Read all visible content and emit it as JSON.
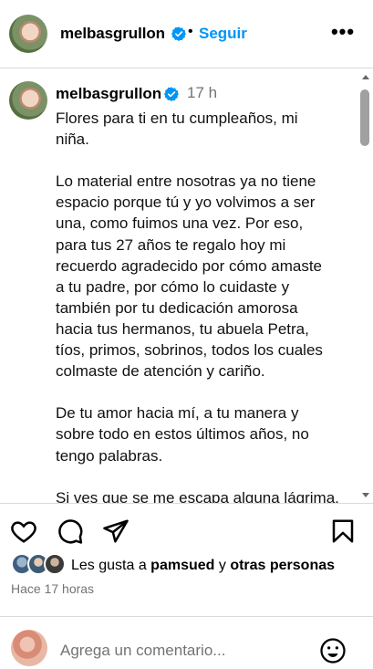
{
  "header": {
    "username": "melbasgrullon",
    "follow_label": "Seguir",
    "dot": "•",
    "more": "•••"
  },
  "post": {
    "username": "melbasgrullon",
    "time": "17 h",
    "caption": "Flores para ti en tu cumpleaños, mi\nniña.\n\nLo material entre nosotras ya no tiene\nespacio porque tú y yo volvimos a ser\nuna, como fuimos una vez. Por eso,\npara tus 27 años te regalo hoy mi\nrecuerdo agradecido por cómo amaste\na tu padre, por cómo lo cuidaste y\ntambién por tu dedicación amorosa\nhacia tus hermanos, tu abuela Petra,\ntíos, primos, sobrinos, todos los cuales\ncolmaste de atención y cariño.\n\nDe tu amor hacia mí, a tu manera y\nsobre todo en estos últimos años, no\ntengo palabras.\n\nSi ves que se me escapa alguna lágrima,"
  },
  "likes": {
    "prefix": "Les gusta a ",
    "user": "pamsued",
    "connector": " y ",
    "others": "otras personas"
  },
  "time_ago": "Hace 17 horas",
  "comment": {
    "placeholder": "Agrega un comentario..."
  },
  "icons": [
    "verified-badge-icon",
    "more-options-icon",
    "heart-icon",
    "comment-icon",
    "share-icon",
    "bookmark-icon",
    "emoji-icon"
  ],
  "colors": {
    "accent": "#0095f6",
    "muted": "#737373",
    "border": "#dbdbdb"
  }
}
